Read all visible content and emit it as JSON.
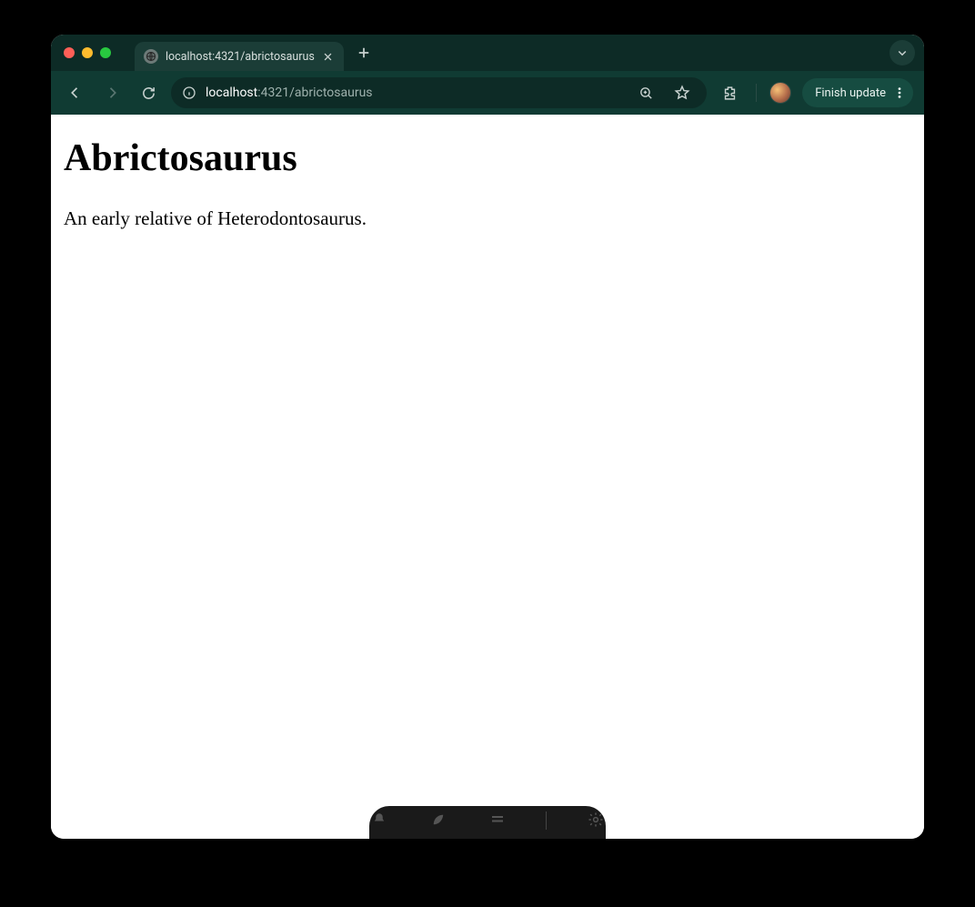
{
  "tab": {
    "title": "localhost:4321/abrictosaurus"
  },
  "url": {
    "host": "localhost",
    "rest": ":4321/abrictosaurus"
  },
  "update_button": {
    "label": "Finish update"
  },
  "page": {
    "heading": "Abrictosaurus",
    "body": "An early relative of Heterodontosaurus."
  }
}
